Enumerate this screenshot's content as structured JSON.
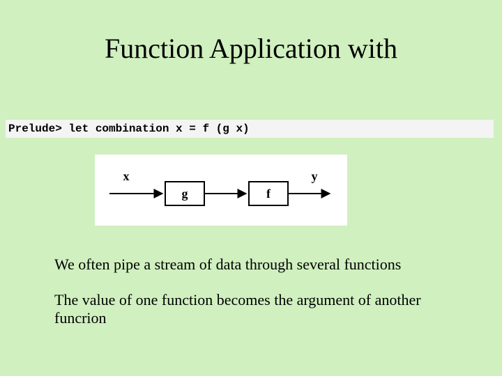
{
  "title": "Function Application with",
  "code_line": "Prelude> let combination x = f (g x)",
  "diagram": {
    "input_label": "x",
    "box1": "g",
    "box2": "f",
    "output_label": "y"
  },
  "paragraph1": "We often pipe a stream of data through several functions",
  "paragraph2": "The value of one function becomes the argument of another funcrion"
}
